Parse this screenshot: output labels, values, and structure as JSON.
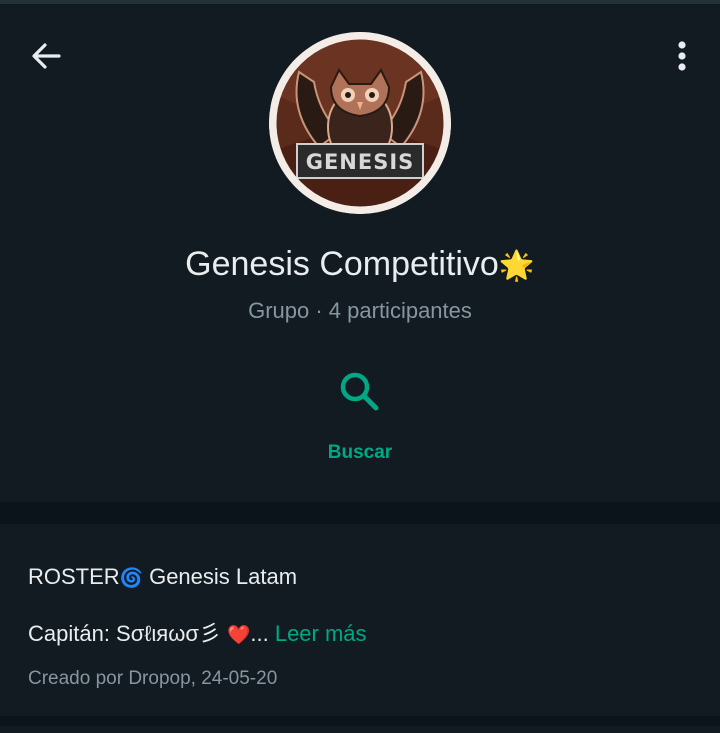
{
  "header": {
    "back_icon": "arrow-left-icon",
    "menu_icon": "more-vertical-icon",
    "avatar_logo_text": "GENESIS",
    "group_name": "Genesis Competitivo",
    "group_name_emoji": "🌟",
    "group_meta": "Grupo · 4 participantes"
  },
  "actions": {
    "search_icon": "search-icon",
    "search_label": "Buscar"
  },
  "description": {
    "line1_prefix": "ROSTER",
    "line1_emoji": "🌀",
    "line1_text": " Genesis Latam",
    "line2_text": "Capitán: Sσℓιяωσ彡 ",
    "line2_emoji": "❤️",
    "line2_ellipsis": "... ",
    "read_more": "Leer más",
    "created_by": "Creado por Dropop, 24-05-20"
  },
  "colors": {
    "background": "#0b141a",
    "card": "#111b21",
    "accent": "#00a884",
    "primary_text": "#e9edef",
    "secondary_text": "#8696a0"
  }
}
